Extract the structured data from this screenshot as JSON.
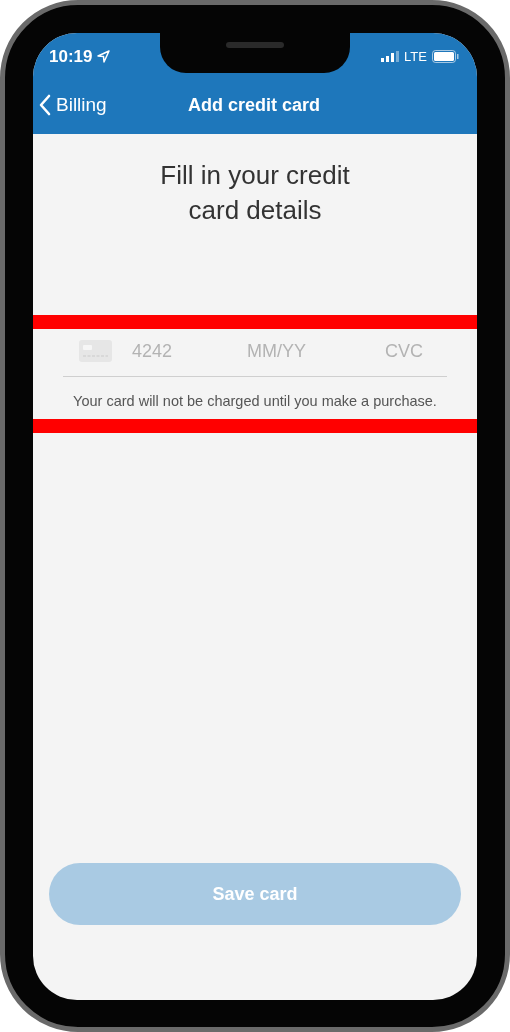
{
  "status_bar": {
    "time": "10:19",
    "network": "LTE"
  },
  "nav_bar": {
    "back_label": "Billing",
    "title": "Add credit card"
  },
  "heading": "Fill in your credit card details",
  "card_form": {
    "highlighted": true,
    "fields": [
      {
        "placeholder": "4242"
      },
      {
        "placeholder": "MM/YY"
      },
      {
        "placeholder": "CVC"
      }
    ],
    "note": "Your card will not be charged until you make a purchase."
  },
  "save_button": {
    "label": "Save card",
    "disabled": true
  }
}
